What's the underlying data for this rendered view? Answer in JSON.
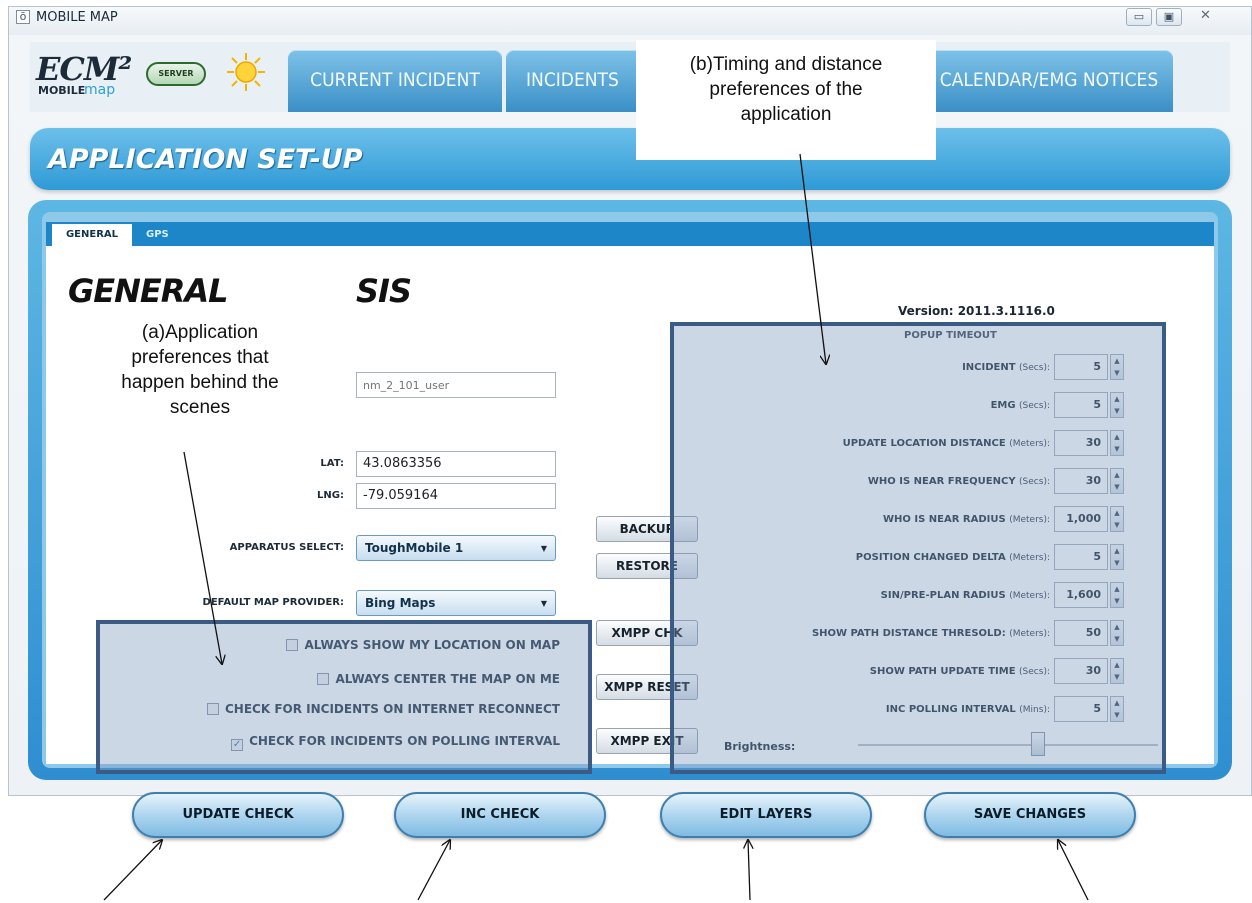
{
  "window": {
    "title": "MOBILE MAP",
    "app_icon": "app-icon",
    "controls": [
      "minimize-icon",
      "maximize-icon",
      "close-icon"
    ]
  },
  "header": {
    "logo_main": "ECM²",
    "logo_mobile": "MOBILE",
    "logo_map": "map",
    "server_badge": "SERVER",
    "status_icon": "sun-icon",
    "tabs": [
      {
        "label": "CURRENT INCIDENT"
      },
      {
        "label": "INCIDENTS"
      },
      {
        "label": "CALENDAR/EMG NOTICES"
      }
    ]
  },
  "section": {
    "title": "APPLICATION SET-UP"
  },
  "subtabs": [
    {
      "label": "GENERAL"
    },
    {
      "label": "GPS"
    }
  ],
  "general": {
    "heading": "GENERAL",
    "sis_heading": "SIS",
    "user_field_placeholder": "nm_2_101_user",
    "lat_label": "LAT:",
    "lat_value": "43.0863356",
    "lng_label": "LNG:",
    "lng_value": "-79.059164",
    "apparatus_label": "APPARATUS SELECT:",
    "apparatus_value": "ToughMobile 1",
    "map_provider_label": "DEFAULT MAP PROVIDER:",
    "map_provider_value": "Bing Maps",
    "checks": [
      {
        "label": "ALWAYS SHOW MY LOCATION ON MAP",
        "checked": false
      },
      {
        "label": "ALWAYS CENTER THE MAP ON ME",
        "checked": false
      },
      {
        "label": "CHECK FOR INCIDENTS ON INTERNET RECONNECT",
        "checked": false
      },
      {
        "label": "CHECK FOR INCIDENTS ON POLLING INTERVAL",
        "checked": true
      }
    ]
  },
  "side_buttons": {
    "backup": "BACKUP",
    "restore": "RESTORE",
    "xmpp_chk": "XMPP CHK",
    "xmpp_reset": "XMPP RESET",
    "xmpp_exit": "XMPP EXIT"
  },
  "prefs": {
    "version": "Version: 2011.3.1116.0",
    "popup_timeout": "POPUP TIMEOUT",
    "rows": [
      {
        "label": "INCIDENT",
        "unit": "(Secs):",
        "value": "5"
      },
      {
        "label": "EMG",
        "unit": "(Secs):",
        "value": "5"
      },
      {
        "label": "UPDATE LOCATION DISTANCE",
        "unit": "(Meters):",
        "value": "30"
      },
      {
        "label": "WHO IS NEAR FREQUENCY",
        "unit": "(Secs):",
        "value": "30"
      },
      {
        "label": "WHO IS NEAR RADIUS",
        "unit": "(Meters):",
        "value": "1,000"
      },
      {
        "label": "POSITION CHANGED DELTA",
        "unit": "(Meters):",
        "value": "5"
      },
      {
        "label": "SIN/PRE-PLAN RADIUS",
        "unit": "(Meters):",
        "value": "1,600"
      },
      {
        "label": "SHOW PATH DISTANCE THRESOLD:",
        "unit": "(Meters):",
        "value": "50"
      },
      {
        "label": "SHOW PATH UPDATE TIME",
        "unit": "(Secs):",
        "value": "30"
      },
      {
        "label": "INC POLLING INTERVAL",
        "unit": "(Mins):",
        "value": "5"
      }
    ],
    "brightness_label": "Brightness:",
    "brightness_level": 0.6
  },
  "bottom_buttons": {
    "update_check": "UPDATE CHECK",
    "inc_check": "INC CHECK",
    "edit_layers": "EDIT LAYERS",
    "save_changes": "SAVE CHANGES"
  },
  "annotations": {
    "a_lines": [
      "(a)Application",
      "preferences that",
      "happen behind the",
      "scenes"
    ],
    "b_lines": [
      "(b)Timing and distance",
      "preferences of the",
      "application"
    ]
  },
  "colors": {
    "tab_blue": "#3a8fc6",
    "annotation_border": "#3b5b85",
    "section_blue": "#2f9ad6"
  }
}
